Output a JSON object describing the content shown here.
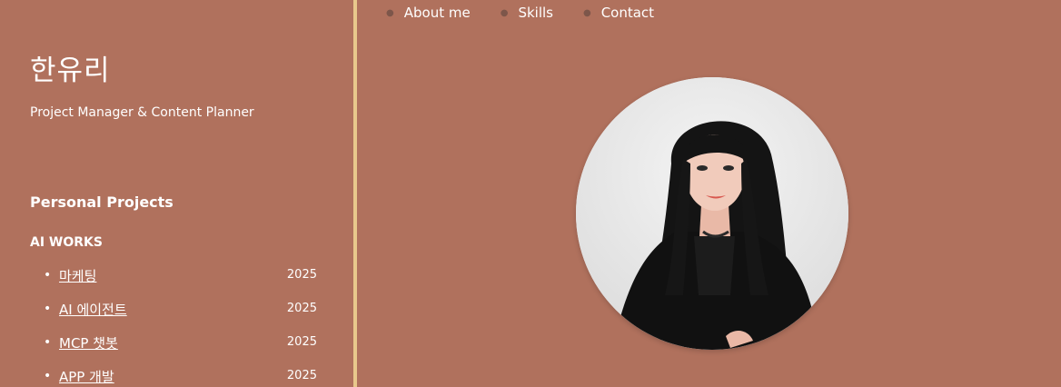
{
  "profile": {
    "name": "한유리",
    "subtitle": "Project Manager & Content Planner"
  },
  "sidebar": {
    "section_title": "Personal Projects",
    "group_title": "AI WORKS",
    "projects": [
      {
        "label": "마케팅",
        "year": "2025"
      },
      {
        "label": "AI 에이전트",
        "year": "2025"
      },
      {
        "label": "MCP 챗봇",
        "year": "2025"
      },
      {
        "label": "APP 개발",
        "year": "2025"
      }
    ]
  },
  "nav": {
    "items": [
      {
        "label": "About me"
      },
      {
        "label": "Skills"
      },
      {
        "label": "Contact"
      }
    ]
  },
  "colors": {
    "background": "#b0715d",
    "divider": "#e8c88c",
    "text": "#ffffff"
  }
}
